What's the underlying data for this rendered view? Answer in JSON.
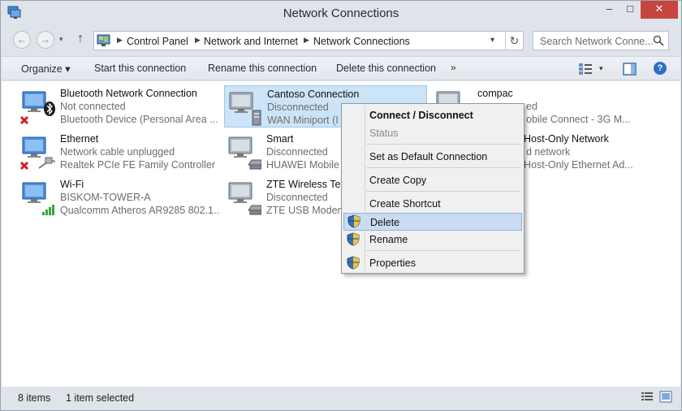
{
  "window": {
    "title": "Network Connections",
    "minimize_symbol": "–",
    "maximize_symbol": "□",
    "close_symbol": "✕"
  },
  "nav": {
    "back_symbol": "←",
    "forward_symbol": "→",
    "up_symbol": "↑",
    "history_symbol": "▾"
  },
  "address": {
    "crumbs": [
      "Control Panel",
      "Network and Internet",
      "Network Connections"
    ],
    "separator": "▶",
    "dropdown_symbol": "▾",
    "refresh_symbol": "↻"
  },
  "search": {
    "placeholder": "Search Network Conne..."
  },
  "toolbar": {
    "organize": "Organize ▾",
    "start": "Start this connection",
    "rename": "Rename this connection",
    "delete": "Delete this connection",
    "more": "»",
    "view_drop": "▾",
    "help": "?"
  },
  "connections": [
    {
      "name": "Bluetooth Network Connection",
      "status": "Not connected",
      "device": "Bluetooth Device (Personal Area ...",
      "icon": "bluetooth-network-icon",
      "badge": "disconnected-x"
    },
    {
      "name": "Ethernet",
      "status": "Network cable unplugged",
      "device": "Realtek PCIe FE Family Controller",
      "icon": "ethernet-icon",
      "badge": "disconnected-x"
    },
    {
      "name": "Wi-Fi",
      "status": "BISKOM-TOWER-A",
      "device": "Qualcomm Atheros AR9285 802.1...",
      "icon": "wifi-icon",
      "badge": "signal-bars"
    },
    {
      "name": "Cantoso Connection",
      "status": "Disconnected",
      "device": "WAN Miniport (I",
      "icon": "vpn-connection-icon",
      "badge": "none"
    },
    {
      "name": "Smart",
      "status": "Disconnected",
      "device": "HUAWEI Mobile",
      "icon": "dialup-modem-icon",
      "badge": "none"
    },
    {
      "name": "ZTE Wireless Ter",
      "status": "Disconnected",
      "device": "ZTE USB Modem",
      "icon": "dialup-modem-icon",
      "badge": "none"
    },
    {
      "name": "compac",
      "status": "ed",
      "device": "obile Connect - 3G M...",
      "icon": "mobile-broadband-icon",
      "badge": "none"
    },
    {
      "name": "Host-Only Network",
      "status": "d network",
      "device": "Host-Only Ethernet Ad...",
      "icon": "virtual-adapter-icon",
      "badge": "none"
    }
  ],
  "context_menu": {
    "connect": "Connect / Disconnect",
    "status": "Status",
    "set_default": "Set as Default Connection",
    "create_copy": "Create Copy",
    "create_shortcut": "Create Shortcut",
    "delete": "Delete",
    "rename": "Rename",
    "properties": "Properties"
  },
  "statusbar": {
    "count": "8 items",
    "selection": "1 item selected"
  },
  "colors": {
    "selection": "#cce4f7",
    "menu_highlight": "#c9dcf3",
    "close_button": "#c7453f",
    "signal_green": "#3aa53a",
    "error_red": "#d11e1e"
  }
}
